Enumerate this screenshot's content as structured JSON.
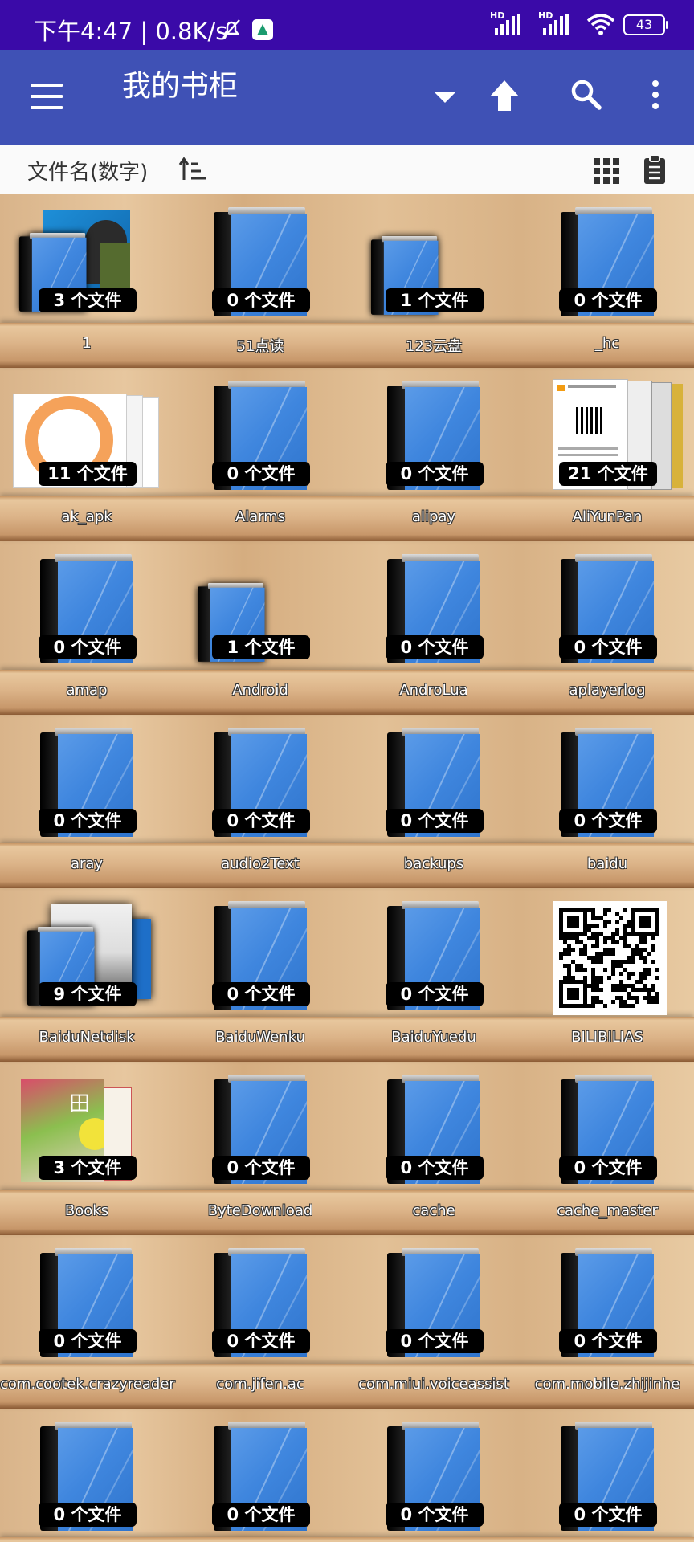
{
  "status_bar": {
    "time": "下午4:47 | 0.8K/s",
    "signal1_label": "HD",
    "signal2_label": "HD",
    "battery": "43"
  },
  "app_bar": {
    "title": "我的书柜",
    "menu_icon": "hamburger-menu-icon",
    "dropdown_icon": "dropdown-arrow-icon",
    "up_icon": "arrow-up-icon",
    "search_icon": "search-icon",
    "more_icon": "more-vertical-icon"
  },
  "sort_bar": {
    "label": "文件名(数字)",
    "sort_icon": "sort-ascending-icon",
    "view_icon": "grid-view-icon",
    "clipboard_icon": "clipboard-icon"
  },
  "colors": {
    "status_bar": "#3a0aa8",
    "app_bar": "#3f51b5",
    "shelf_wood": "#d9b489",
    "book_blue": "#3f86de"
  },
  "folders": [
    {
      "name": "1",
      "count": "3 个文件",
      "cover": "image"
    },
    {
      "name": "51点读",
      "count": "0 个文件",
      "cover": "book"
    },
    {
      "name": "123云盘",
      "count": "1 个文件",
      "cover": "book-small"
    },
    {
      "name": "_hc",
      "count": "0 个文件",
      "cover": "book"
    },
    {
      "name": "ak_apk",
      "count": "11 个文件",
      "cover": "image"
    },
    {
      "name": "Alarms",
      "count": "0 个文件",
      "cover": "book"
    },
    {
      "name": "alipay",
      "count": "0 个文件",
      "cover": "book"
    },
    {
      "name": "AliYunPan",
      "count": "21 个文件",
      "cover": "image"
    },
    {
      "name": "amap",
      "count": "0 个文件",
      "cover": "book"
    },
    {
      "name": "Android",
      "count": "1 个文件",
      "cover": "book-small"
    },
    {
      "name": "AndroLua",
      "count": "0 个文件",
      "cover": "book"
    },
    {
      "name": "aplayerlog",
      "count": "0 个文件",
      "cover": "book"
    },
    {
      "name": "aray",
      "count": "0 个文件",
      "cover": "book"
    },
    {
      "name": "audio2Text",
      "count": "0 个文件",
      "cover": "book"
    },
    {
      "name": "backups",
      "count": "0 个文件",
      "cover": "book"
    },
    {
      "name": "baidu",
      "count": "0 个文件",
      "cover": "book"
    },
    {
      "name": "BaiduNetdisk",
      "count": "9 个文件",
      "cover": "image"
    },
    {
      "name": "BaiduWenku",
      "count": "0 个文件",
      "cover": "book"
    },
    {
      "name": "BaiduYuedu",
      "count": "0 个文件",
      "cover": "book"
    },
    {
      "name": "BILIBILIAS",
      "count": "",
      "cover": "qr"
    },
    {
      "name": "Books",
      "count": "3 个文件",
      "cover": "image"
    },
    {
      "name": "ByteDownload",
      "count": "0 个文件",
      "cover": "book"
    },
    {
      "name": "cache",
      "count": "0 个文件",
      "cover": "book"
    },
    {
      "name": "cache_master",
      "count": "0 个文件",
      "cover": "book"
    },
    {
      "name": "com.cootek.crazyreader",
      "count": "0 个文件",
      "cover": "book"
    },
    {
      "name": "com.jifen.ac",
      "count": "0 个文件",
      "cover": "book"
    },
    {
      "name": "com.miui.voiceassist",
      "count": "0 个文件",
      "cover": "book"
    },
    {
      "name": "com.mobile.zhijinhe",
      "count": "0 个文件",
      "cover": "book"
    },
    {
      "name": "",
      "count": "0 个文件",
      "cover": "book"
    },
    {
      "name": "",
      "count": "0 个文件",
      "cover": "book"
    },
    {
      "name": "",
      "count": "0 个文件",
      "cover": "book"
    },
    {
      "name": "",
      "count": "0 个文件",
      "cover": "book"
    }
  ]
}
